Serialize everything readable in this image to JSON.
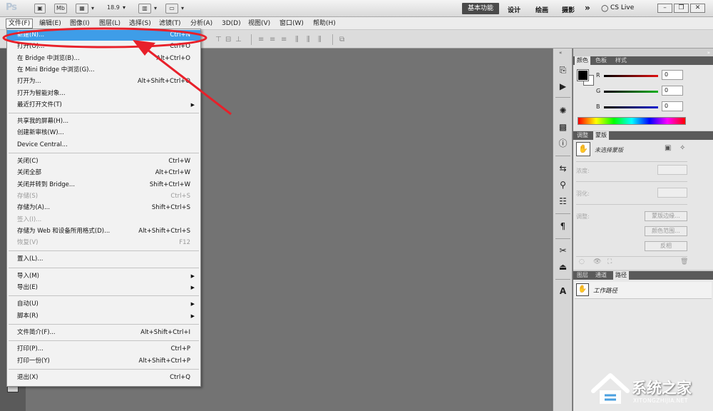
{
  "appbar": {
    "logo": "Ps",
    "zoom": "18.9",
    "workspaces": {
      "essentials": "基本功能",
      "design": "设计",
      "painting": "绘画",
      "photography": "摄影",
      "more": "»"
    },
    "cslive": "CS Live"
  },
  "menubar": [
    "文件(F)",
    "编辑(E)",
    "图像(I)",
    "图层(L)",
    "选择(S)",
    "滤镜(T)",
    "分析(A)",
    "3D(D)",
    "视图(V)",
    "窗口(W)",
    "帮助(H)"
  ],
  "file_menu": {
    "items": [
      {
        "label": "新建(N)...",
        "shortcut": "Ctrl+N",
        "highlight": true
      },
      {
        "label": "打开(O)...",
        "shortcut": "Ctrl+O"
      },
      {
        "label": "在 Bridge 中浏览(B)...",
        "shortcut": "Alt+Ctrl+O"
      },
      {
        "label": "在 Mini Bridge 中浏览(G)...",
        "shortcut": ""
      },
      {
        "label": "打开为...",
        "shortcut": "Alt+Shift+Ctrl+O"
      },
      {
        "label": "打开为智能对象...",
        "shortcut": ""
      },
      {
        "label": "最近打开文件(T)",
        "shortcut": "",
        "submenu": true
      },
      {
        "label": "共享我的屏幕(H)...",
        "shortcut": ""
      },
      {
        "label": "创建新审核(W)...",
        "shortcut": ""
      },
      {
        "label": "Device Central...",
        "shortcut": ""
      },
      {
        "label": "关闭(C)",
        "shortcut": "Ctrl+W"
      },
      {
        "label": "关闭全部",
        "shortcut": "Alt+Ctrl+W"
      },
      {
        "label": "关闭并转到 Bridge...",
        "shortcut": "Shift+Ctrl+W"
      },
      {
        "label": "存储(S)",
        "shortcut": "Ctrl+S",
        "disabled": true
      },
      {
        "label": "存储为(A)...",
        "shortcut": "Shift+Ctrl+S"
      },
      {
        "label": "签入(I)...",
        "shortcut": "",
        "disabled": true
      },
      {
        "label": "存储为 Web 和设备所用格式(D)...",
        "shortcut": "Alt+Shift+Ctrl+S"
      },
      {
        "label": "恢复(V)",
        "shortcut": "F12",
        "disabled": true
      },
      {
        "label": "置入(L)...",
        "shortcut": ""
      },
      {
        "label": "导入(M)",
        "shortcut": "",
        "submenu": true
      },
      {
        "label": "导出(E)",
        "shortcut": "",
        "submenu": true
      },
      {
        "label": "自动(U)",
        "shortcut": "",
        "submenu": true
      },
      {
        "label": "脚本(R)",
        "shortcut": "",
        "submenu": true
      },
      {
        "label": "文件简介(F)...",
        "shortcut": "Alt+Shift+Ctrl+I"
      },
      {
        "label": "打印(P)...",
        "shortcut": "Ctrl+P"
      },
      {
        "label": "打印一份(Y)",
        "shortcut": "Alt+Shift+Ctrl+P"
      },
      {
        "label": "退出(X)",
        "shortcut": "Ctrl+Q"
      }
    ]
  },
  "color_panel": {
    "tabs": [
      "颜色",
      "色板",
      "样式"
    ],
    "channels": [
      {
        "label": "R",
        "value": "0",
        "color": "#e01010"
      },
      {
        "label": "G",
        "value": "0",
        "color": "#10b020"
      },
      {
        "label": "B",
        "value": "0",
        "color": "#1020d0"
      }
    ]
  },
  "masks_panel": {
    "tabs": [
      "调整",
      "蒙版"
    ],
    "status": "未选择蒙版",
    "density_label": "浓度:",
    "feather_label": "羽化:",
    "refine_label": "调整:",
    "buttons": [
      "蒙版边缘...",
      "颜色范围...",
      "反相"
    ]
  },
  "paths_panel": {
    "tabs": [
      "图层",
      "通道",
      "路径"
    ],
    "item": "工作路径"
  },
  "watermark": {
    "text": "系统之家",
    "url": "XITONGZHIJIA.NET"
  },
  "colors": {
    "highlight": "#3e9de8",
    "annotation": "#e8202a"
  }
}
